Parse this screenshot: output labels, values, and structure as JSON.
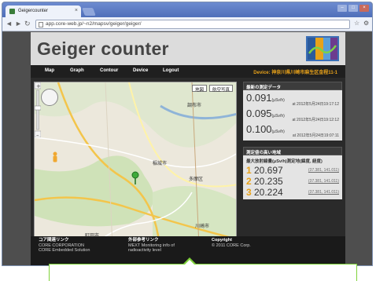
{
  "browser": {
    "tab_title": "Geigercounter",
    "url": "app.core-web.jp/~n2/mapsv/geiger/geiger/",
    "tab_close": "×",
    "nav_back": "◄",
    "nav_forward": "►",
    "nav_reload": "↻"
  },
  "site": {
    "title": "Geiger counter",
    "menu": [
      "Map",
      "Graph",
      "Contour",
      "Device",
      "Logout"
    ],
    "device_label": "Device: 神奈川県川崎市麻生区金程11-1",
    "colors": {
      "accent": "#e8a21a",
      "header_bg": "#dcdcdc",
      "nav_bg": "#1f1f1f",
      "callout_border": "#7fd23a"
    }
  },
  "map": {
    "map_button": "地図",
    "satellite_button": "航空写真",
    "place_labels": [
      "調布市",
      "稲城市",
      "多摩区",
      "町田市",
      "川崎市"
    ],
    "copyright": "地図データ ©2012 Google, ZENRIN"
  },
  "latest": {
    "header": "最新の測定データ",
    "unit": "(μSv/h)",
    "readings": [
      {
        "value": "0.091",
        "time": "at 2012年5月24日19:17:12"
      },
      {
        "value": "0.095",
        "time": "at 2012年5月24日19:12:12"
      },
      {
        "value": "0.100",
        "time": "at 2012年5月24日19:07:11"
      }
    ]
  },
  "ranking": {
    "header": "測定値の高い地域",
    "col_value": "最大放射線量(μSv/h)",
    "col_location": "測定地(緯度, 経度)",
    "rows": [
      {
        "rank": "1",
        "value": "20.697",
        "coord": "(37.381, 141.011)"
      },
      {
        "rank": "2",
        "value": "20.235",
        "coord": "(37.381, 141.011)"
      },
      {
        "rank": "3",
        "value": "20.224",
        "coord": "(37.381, 141.011)"
      }
    ]
  },
  "footer": {
    "col1_title": "コア関連リンク",
    "col1_lines": [
      "CORE CORPORATION",
      "CORE Embedded Solution"
    ],
    "col2_title": "外部参考リンク",
    "col2_lines": [
      "MEXT Monitoring info of",
      "radioactivity level"
    ],
    "col3_title": "Copyright",
    "col3_lines": [
      "© 2011 CORE Corp."
    ]
  }
}
